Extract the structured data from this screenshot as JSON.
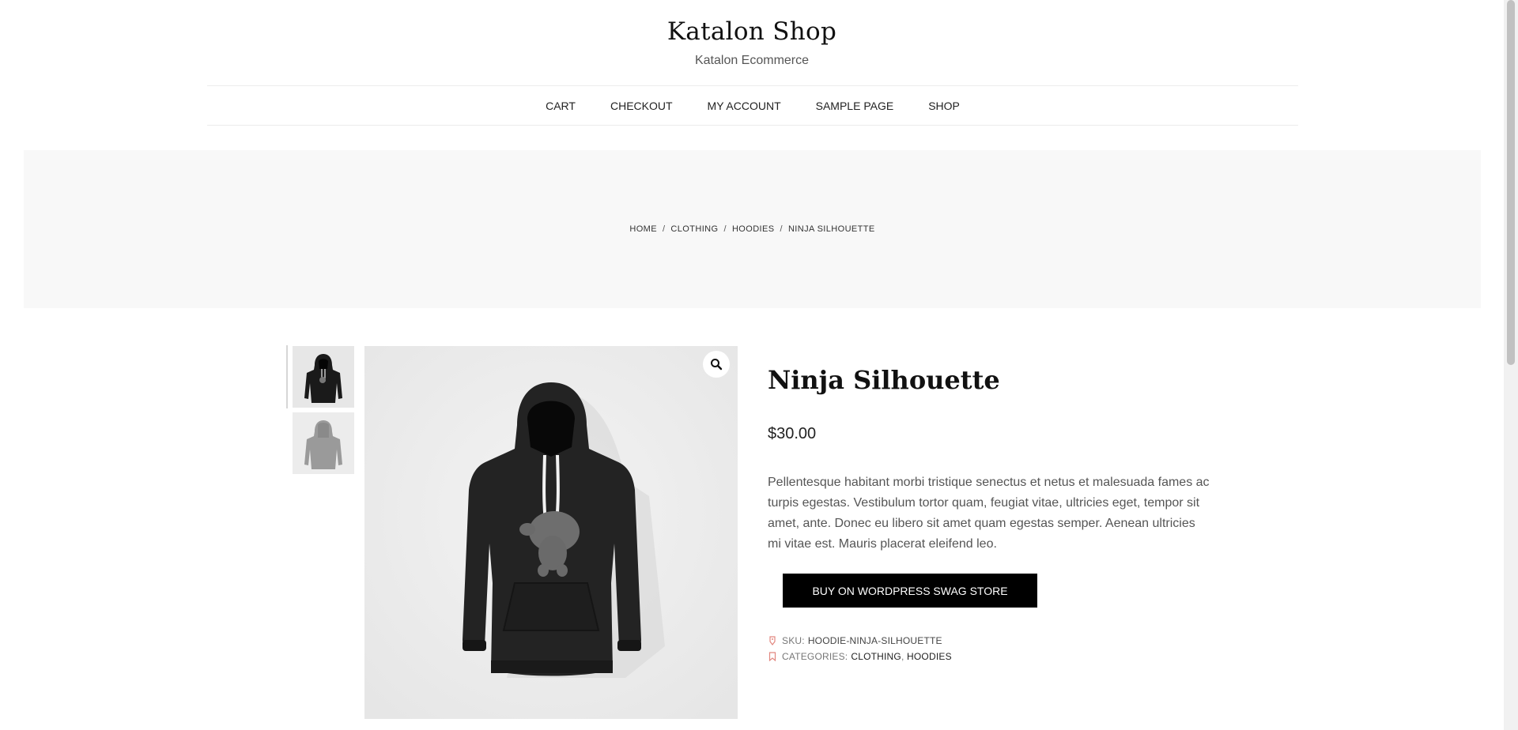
{
  "site": {
    "title": "Katalon Shop",
    "description": "Katalon Ecommerce"
  },
  "nav": {
    "items": [
      "CART",
      "CHECKOUT",
      "MY ACCOUNT",
      "SAMPLE PAGE",
      "SHOP"
    ]
  },
  "breadcrumb": {
    "items": [
      "HOME",
      "CLOTHING",
      "HOODIES",
      "NINJA SILHOUETTE"
    ],
    "separator": "/"
  },
  "product": {
    "title": "Ninja Silhouette",
    "price": "$30.00",
    "description": "Pellentesque habitant morbi tristique senectus et netus et malesuada fames ac turpis egestas. Vestibulum tortor quam, feugiat vitae, ultricies eget, tempor sit amet, ante. Donec eu libero sit amet quam egestas semper. Aenean ultricies mi vitae est. Mauris placerat eleifend leo.",
    "buy_label": "BUY ON WORDPRESS SWAG STORE",
    "sku_label": "SKU:",
    "sku": "HOODIE-NINJA-SILHOUETTE",
    "categories_label": "CATEGORIES:",
    "categories": [
      "CLOTHING",
      "HOODIES"
    ],
    "category_separator": ","
  },
  "icons": {
    "zoom": "search-icon",
    "sku": "tag-icon",
    "categories": "bookmark-icon"
  },
  "colors": {
    "accent": "#e2877f",
    "button_bg": "#000000",
    "hero_bg": "#f8f8f8"
  }
}
